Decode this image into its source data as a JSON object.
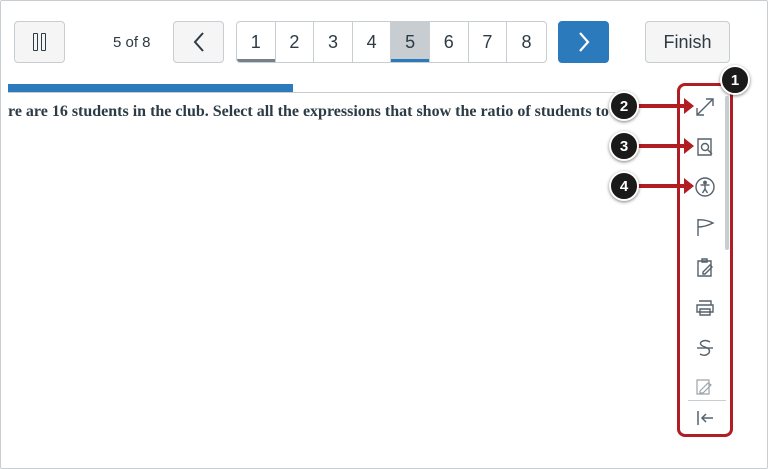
{
  "toolbar": {
    "question_count": "5 of 8",
    "finish_label": "Finish",
    "pages": [
      "1",
      "2",
      "3",
      "4",
      "5",
      "6",
      "7",
      "8"
    ]
  },
  "progress": {
    "fraction": 0.47
  },
  "question": {
    "text": "re are 16 students in the club. Select all the expressions that show the ratio of students to"
  },
  "sidebar_tools": [
    "expand-icon",
    "search-document-icon",
    "accessibility-icon",
    "flag-icon",
    "clipboard-edit-icon",
    "print-icon",
    "strikethrough-icon",
    "annotate-icon",
    "collapse-icon"
  ],
  "callouts": [
    "1",
    "2",
    "3",
    "4"
  ],
  "colors": {
    "accent": "#2b7abc",
    "highlight": "#b01d23"
  }
}
